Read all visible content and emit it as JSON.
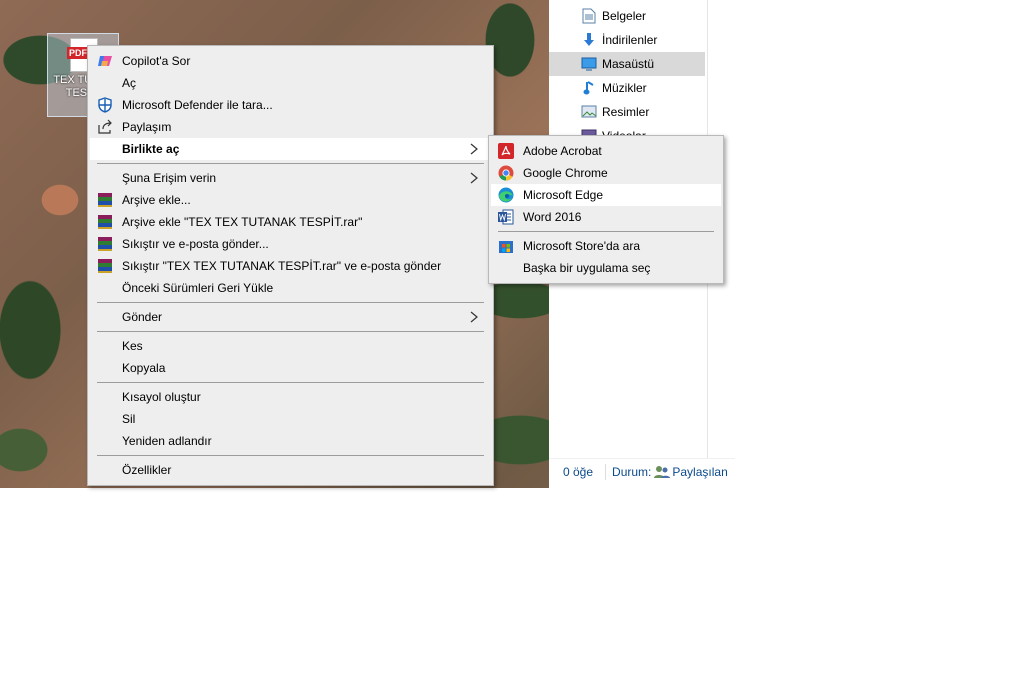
{
  "desktop": {
    "file_icon": {
      "badge": "PDF",
      "label": "TEX TUTA... TESP..."
    }
  },
  "explorer": {
    "nav_items": [
      {
        "label": "Belgeler",
        "icon": "documents-icon"
      },
      {
        "label": "İndirilenler",
        "icon": "downloads-icon"
      },
      {
        "label": "Masaüstü",
        "icon": "desktop-icon",
        "selected": true
      },
      {
        "label": "Müzikler",
        "icon": "music-icon"
      },
      {
        "label": "Resimler",
        "icon": "pictures-icon"
      },
      {
        "label": "Videolar",
        "icon": "videos-icon"
      }
    ],
    "status": {
      "count": "0 öğe",
      "state_label": "Durum:",
      "state_value": "Paylaşılan"
    }
  },
  "context_menu": {
    "items": [
      {
        "label": "Copilot'a Sor",
        "icon": "copilot-icon"
      },
      {
        "label": "Aç"
      },
      {
        "label": "Microsoft Defender ile tara...",
        "icon": "defender-shield-icon"
      },
      {
        "label": "Paylaşım",
        "icon": "share-icon"
      },
      {
        "label": "Birlikte aç",
        "bold": true,
        "submenu": true
      },
      {
        "label": "Şuna Erişim verin",
        "submenu": true
      },
      {
        "label": "Arşive ekle...",
        "icon": "winrar-icon"
      },
      {
        "label": "Arşive ekle \"TEX TEX TUTANAK TESPİT.rar\"",
        "icon": "winrar-icon"
      },
      {
        "label": "Sıkıştır ve e-posta gönder...",
        "icon": "winrar-icon"
      },
      {
        "label": "Sıkıştır \"TEX TEX TUTANAK TESPİT.rar\" ve e-posta gönder",
        "icon": "winrar-icon"
      },
      {
        "label": "Önceki Sürümleri Geri Yükle"
      },
      {
        "label": "Gönder",
        "submenu": true
      },
      {
        "label": "Kes"
      },
      {
        "label": "Kopyala"
      },
      {
        "label": "Kısayol oluştur"
      },
      {
        "label": "Sil"
      },
      {
        "label": "Yeniden adlandır"
      },
      {
        "label": "Özellikler"
      }
    ]
  },
  "open_with_menu": {
    "items": [
      {
        "label": "Adobe Acrobat",
        "icon": "adobe-acrobat-icon"
      },
      {
        "label": "Google Chrome",
        "icon": "chrome-icon"
      },
      {
        "label": "Microsoft Edge",
        "icon": "edge-icon",
        "highlighted": true
      },
      {
        "label": "Word 2016",
        "icon": "word-icon"
      },
      {
        "label": "Microsoft Store'da ara",
        "icon": "store-icon"
      },
      {
        "label": "Başka bir uygulama seç"
      }
    ]
  },
  "colors": {
    "menu_bg": "#eeeeee",
    "highlight": "#ffffff",
    "selected_nav": "#d9d9d9",
    "acrobat_red": "#d3262a"
  }
}
